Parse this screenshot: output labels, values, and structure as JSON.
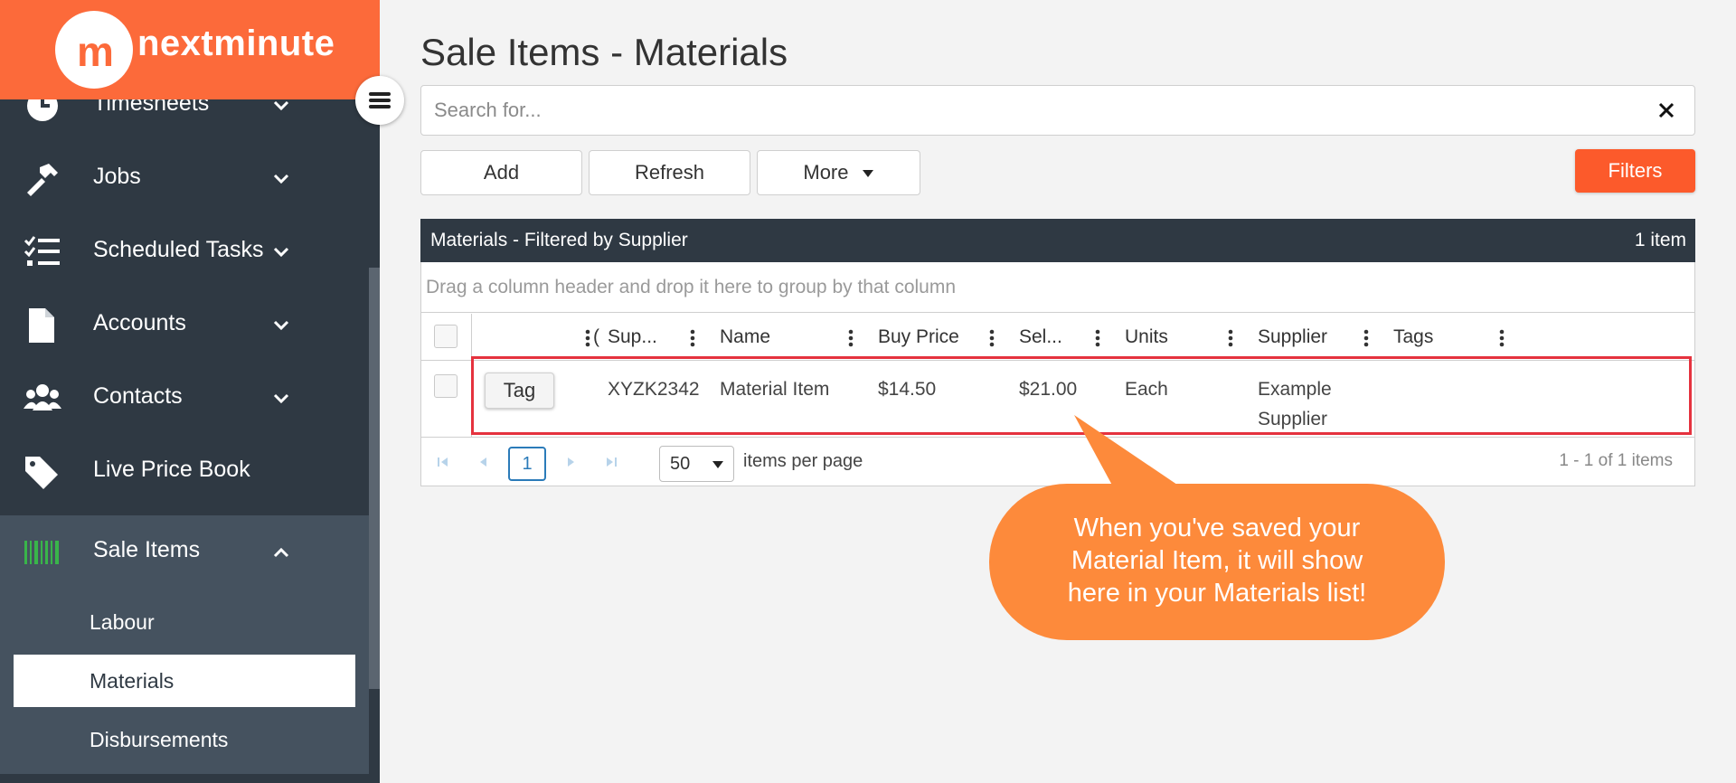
{
  "brand": {
    "name": "nextminute",
    "logo_mark": "m",
    "color": "#fc6a3a"
  },
  "sidebar": {
    "items": [
      {
        "label": "Timesheets",
        "icon": "clock-icon",
        "expanded": false
      },
      {
        "label": "Jobs",
        "icon": "hammer-icon",
        "expanded": false
      },
      {
        "label": "Scheduled Tasks",
        "icon": "task-list-icon",
        "expanded": false
      },
      {
        "label": "Accounts",
        "icon": "document-icon",
        "expanded": false
      },
      {
        "label": "Contacts",
        "icon": "users-icon",
        "expanded": false
      },
      {
        "label": "Live Price Book",
        "icon": "tag-icon"
      },
      {
        "label": "Sale Items",
        "icon": "barcode-icon",
        "expanded": true
      }
    ],
    "sub_items": [
      {
        "label": "Labour",
        "selected": false
      },
      {
        "label": "Materials",
        "selected": true
      },
      {
        "label": "Disbursements",
        "selected": false
      }
    ]
  },
  "page": {
    "title": "Sale Items - Materials"
  },
  "search": {
    "placeholder": "Search for..."
  },
  "toolbar": {
    "add_label": "Add",
    "refresh_label": "Refresh",
    "more_label": "More",
    "filters_label": "Filters",
    "filters_color": "#fc5a2b"
  },
  "grid": {
    "title": "Materials - Filtered by Supplier",
    "count": "1 item",
    "group_hint": "Drag a column header and drop it here to group by that column",
    "columns": [
      "Sup...",
      "Name",
      "Buy Price",
      "Sel...",
      "Units",
      "Supplier",
      "Tags"
    ],
    "rows": [
      {
        "action": "Tag",
        "code": "XYZK2342",
        "name": "Material Item",
        "buy_price": "$14.50",
        "sell_price": "$21.00",
        "units": "Each",
        "supplier_line1": "Example",
        "supplier_line2": "Supplier",
        "tags": ""
      }
    ],
    "pager": {
      "current_page": "1",
      "per_page": "50",
      "per_page_label": "items per page",
      "info": "1 - 1 of 1 items"
    }
  },
  "callout": {
    "line1": "When you've saved your",
    "line2": "Material Item, it will show",
    "line3": "here in your Materials list!",
    "color": "#fd8a3b",
    "highlight_color": "#e5323e"
  }
}
